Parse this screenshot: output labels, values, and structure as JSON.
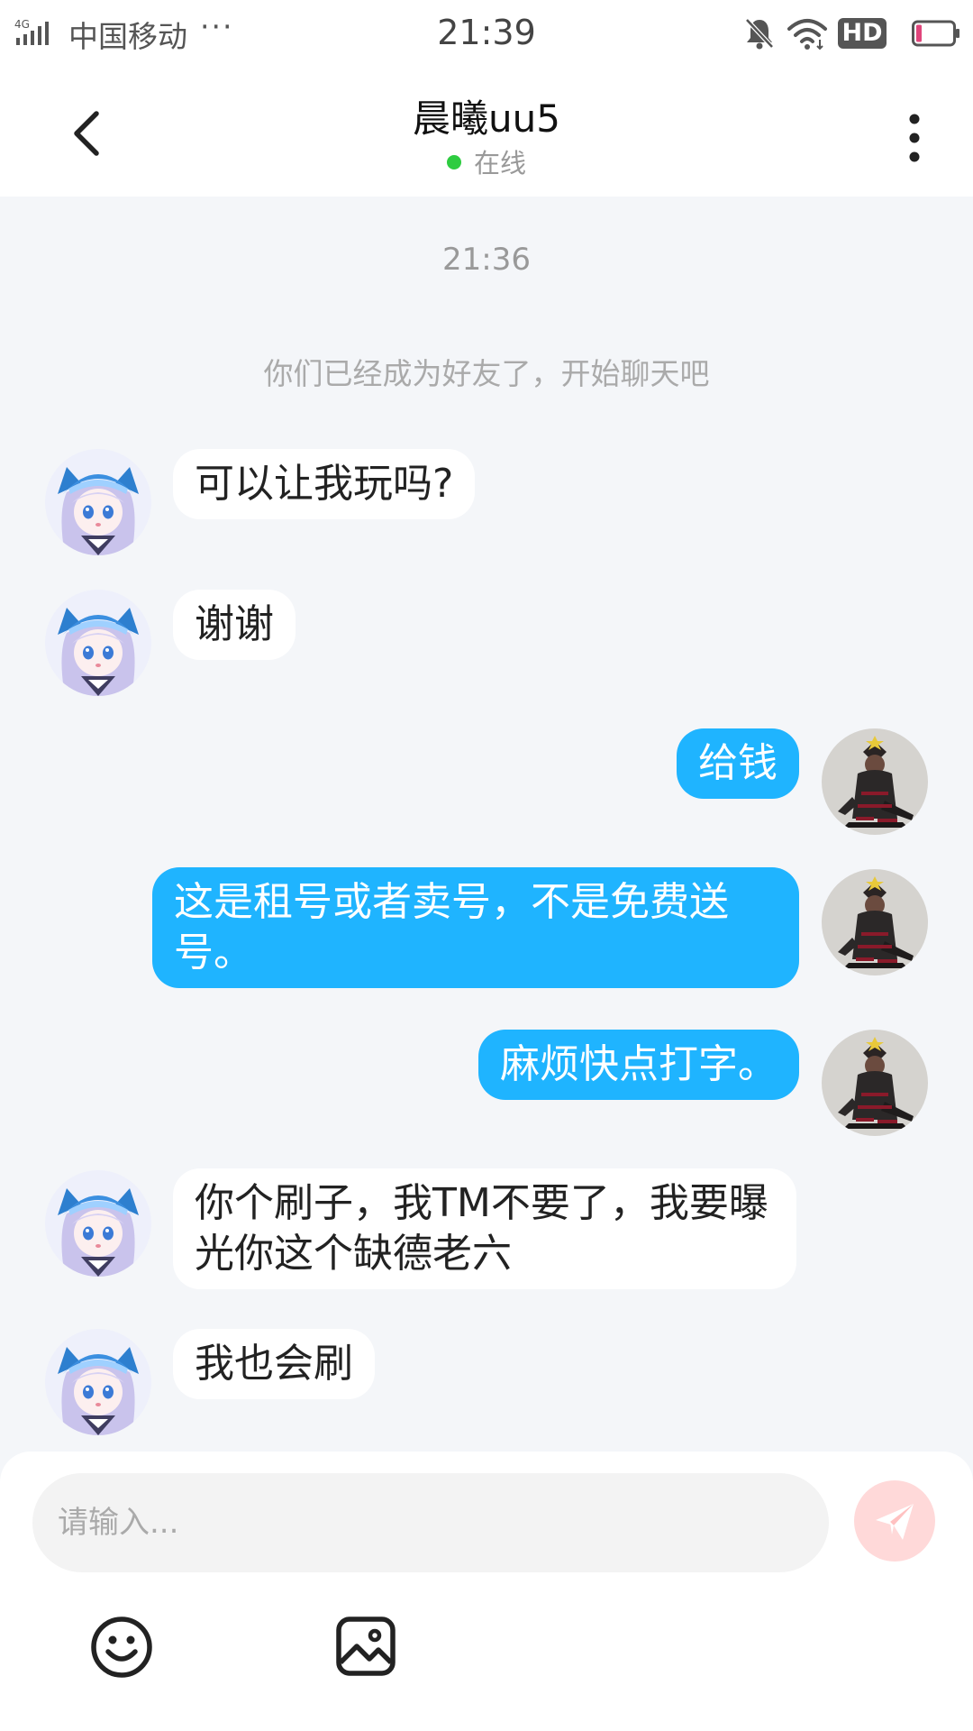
{
  "status_bar": {
    "network": "4G",
    "carrier": "中国移动",
    "more": "···",
    "time": "21:39",
    "hd": "HD",
    "icons": [
      "signal-icon",
      "mute-bell-icon",
      "wifi-icon",
      "battery-icon"
    ]
  },
  "header": {
    "name": "晨曦uu5",
    "status": "在线",
    "status_color": "#2ecc40"
  },
  "chat": {
    "time": "21:36",
    "system_notice": "你们已经成为好友了，开始聊天吧",
    "messages": [
      {
        "side": "in",
        "text": "可以让我玩吗?"
      },
      {
        "side": "in",
        "text": "谢谢"
      },
      {
        "side": "out",
        "text": "给钱"
      },
      {
        "side": "out",
        "text": "这是租号或者卖号，不是免费送号。"
      },
      {
        "side": "out",
        "text": "麻烦快点打字。"
      },
      {
        "side": "in",
        "text": "你个刷子，我TM不要了，我要曝光你这个缺德老六"
      },
      {
        "side": "in",
        "text": "我也会刷"
      }
    ]
  },
  "composer": {
    "placeholder": "请输入...",
    "send_icon": "paper-plane-icon",
    "tools": [
      "emoji-icon",
      "image-icon"
    ]
  },
  "colors": {
    "outgoing_bubble": "#1fb4ff",
    "incoming_bubble": "#ffffff",
    "background": "#f4f6f9",
    "send_button": "#ffd9d9"
  }
}
